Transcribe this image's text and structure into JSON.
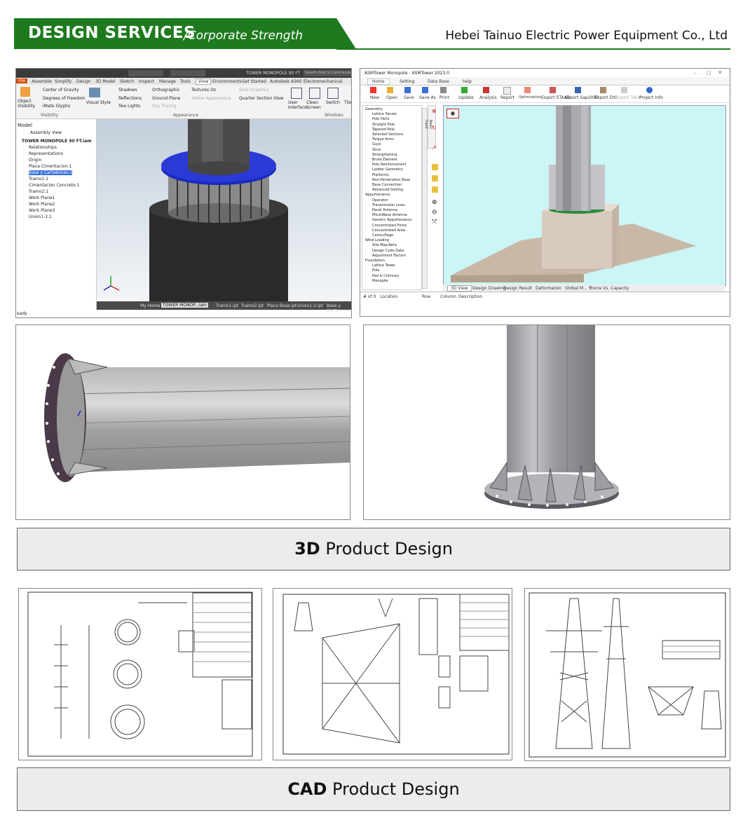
{
  "header": {
    "title": "DESIGN SERVICES",
    "subtitle": "/Corporate Strength",
    "company": "Hebei Tainuo Electric Power Equipment Co., Ltd",
    "brand_green": "#1e7a1e"
  },
  "inventor": {
    "menu": [
      "File",
      "Assemble",
      "Simplify",
      "Design",
      "3D Model",
      "Sketch",
      "Inspect",
      "Manage",
      "Tools",
      "View",
      "Environments",
      "Get Started",
      "Autodesk A360",
      "Electromechanical"
    ],
    "active_menu": "View",
    "window_title": "TOWER MONOPOLE 90 FT",
    "search_placeholder": "Search Help & Commands",
    "visibility": {
      "object_visibility": "Object Visibility",
      "center_of_gravity": "Center of Gravity",
      "degrees_of_freedom": "Degrees of Freedom",
      "imate_glyphs": "iMate Glyphs",
      "group": "Visibility"
    },
    "appearance": {
      "visual_style": "Visual Style",
      "shadows": "Shadows",
      "reflections": "Reflections",
      "two_lights": "Two Lights",
      "orthographic": "Orthographic",
      "ground_plane": "Ground Plane",
      "ray_tracing": "Ray Tracing",
      "textures_on": "Textures On",
      "yellow_appearance": "Yellow Appearance",
      "slice_graphics": "Slice Graphics",
      "quarter_section": "Quarter Section View",
      "group": "Appearance"
    },
    "windows": {
      "user_interface": "User Interface",
      "clean_screen": "Clean Screen",
      "switch": "Switch",
      "tile": "Tile",
      "group": "Windows"
    },
    "browser_title": "Model",
    "browser_view": "Assembly View",
    "tree": [
      "TOWER MONOPOLE 90 FT.iam",
      "Relationships",
      "Representations",
      "Origin",
      "Placa Cimentacion:1",
      "Base y Cartabones:1",
      "Tramo1:1",
      "Cimentacion Concreto:1",
      "Tramo2:1",
      "Work Plane1",
      "Work Plane2",
      "Work Plane3",
      "Union1-2:1"
    ],
    "doc_tabs": [
      "My Home",
      "TOWER MONOP...iam",
      "Tramo1.ipt",
      "Tramo2.ipt",
      "Placa Base.ipt",
      "Union1-2.ipt",
      "Base y Carta"
    ],
    "status": "eady"
  },
  "asm": {
    "window_title": "ASMTower Monopole - ASMTower 2023.0",
    "tabs": [
      "Home",
      "Setting",
      "Data Base",
      "help"
    ],
    "active_tab": "Home",
    "toolbar": [
      "New",
      "Open",
      "Save",
      "Save As",
      "Print",
      "Update",
      "Analysis",
      "Report",
      "Optimization",
      "Export STAAD",
      "Export Sap2000",
      "Export DXF",
      "Export Tekla",
      "Project Info"
    ],
    "side_tab": "Basic Input",
    "tree": [
      "Geometry",
      "Lattice Panels",
      "Pole Parts",
      "Straight Pole",
      "Tapered Pole",
      "Selected Sections",
      "Torque Arms",
      "Guys",
      "Strut",
      "Strengthening",
      "Brute Element",
      "Pole Reinforcement",
      "Ladder Geometry",
      "Platforms",
      "Non-Penetration Base",
      "Base Connection",
      "Advanced Setting",
      "Appurtenance",
      "Operator",
      "Transmission Lines",
      "Panel Antenna",
      "MicroWave Antenna",
      "Generic Appurtenance",
      "Concentrated Force",
      "Concentrated Area",
      "Camouflage",
      "Wind Loading",
      "Site Map-Beta",
      "Design Code Data",
      "Adjustment Factors",
      "Foundation",
      "Lattice Tower",
      "Pole",
      "Pad & Chimney",
      "Monopile"
    ],
    "view_tabs": [
      "3D View",
      "Design Drawing",
      "Design Result",
      "Deformation",
      "Global M... S",
      "Force Vs. Capacity"
    ],
    "grid_headers": [
      "# of 0",
      "Location",
      "Row",
      "Column",
      "Description"
    ]
  },
  "bands": {
    "design_3d_bold": "3D",
    "design_3d_rest": " Product Design",
    "cad_bold": "CAD",
    "cad_rest": " Product Design"
  }
}
